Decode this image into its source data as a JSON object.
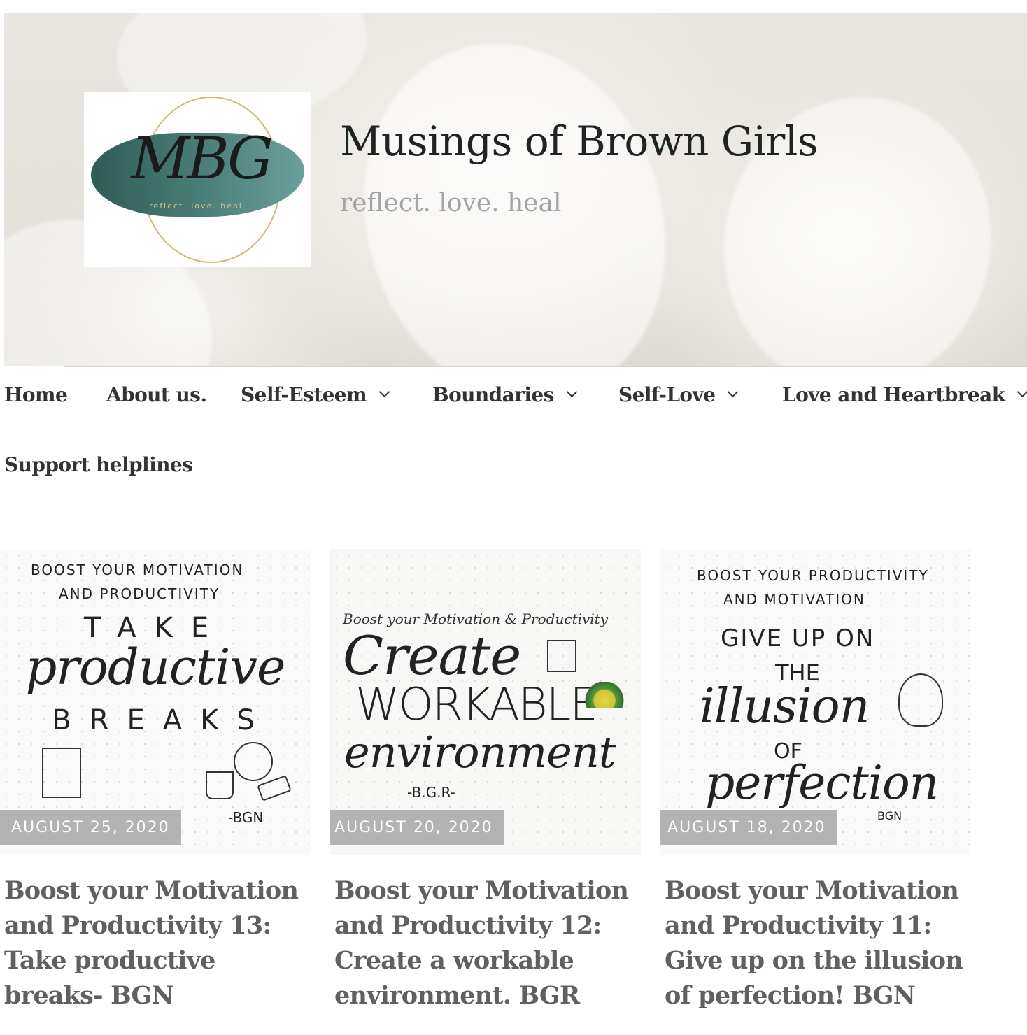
{
  "header": {
    "site_title": "Musings of Brown Girls",
    "tagline": "reflect. love. heal",
    "logo": {
      "mark": "MBG",
      "tag": "reflect. love. heal"
    }
  },
  "nav": {
    "items": [
      {
        "label": "Home",
        "dropdown": false
      },
      {
        "label": "About us.",
        "dropdown": false
      },
      {
        "label": "Self-Esteem",
        "dropdown": true
      },
      {
        "label": "Boundaries",
        "dropdown": true
      },
      {
        "label": "Self-Love",
        "dropdown": true
      },
      {
        "label": "Love and Heartbreak",
        "dropdown": true
      },
      {
        "label": "Support helplines",
        "dropdown": false
      }
    ]
  },
  "posts": [
    {
      "date": "AUGUST 25, 2020",
      "title": "Boost your Motivation and Productivity 13: Take productive breaks- BGN",
      "image_text": {
        "line1": "BOOST YOUR MOTIVATION",
        "line2": "AND PRODUCTIVITY",
        "line3": "TAKE",
        "line4": "productive",
        "line5": "BREAKS",
        "sign": "-BGN"
      }
    },
    {
      "date": "AUGUST 20, 2020",
      "title": "Boost your Motivation and Productivity 12: Create a workable environment. BGR",
      "image_text": {
        "line1": "Boost your Motivation & Productivity",
        "line2": "Create",
        "line3": "WORKABLE",
        "line4": "environment",
        "sign": "-B.G.R-"
      }
    },
    {
      "date": "AUGUST 18, 2020",
      "title": "Boost your Motivation and Productivity 11: Give up on the illusion of perfection! BGN",
      "image_text": {
        "line1": "BOOST YOUR PRODUCTIVITY",
        "line2": "AND MOTIVATION",
        "line3": "GIVE UP ON",
        "line4": "THE",
        "line5": "illusion",
        "line6": "OF",
        "line7": "perfection",
        "sign": "BGN"
      }
    }
  ],
  "colors": {
    "date_badge": "#b3b3b3",
    "title_text": "#1d2421",
    "tagline_text": "#a3a3a3",
    "nav_text": "#333333",
    "post_title_text": "#606060"
  }
}
